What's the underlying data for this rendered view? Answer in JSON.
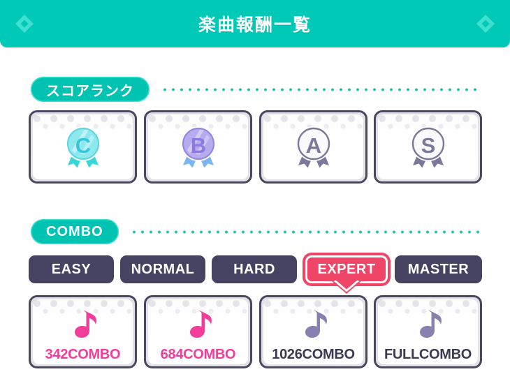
{
  "header": {
    "title": "楽曲報酬一覧",
    "background_color": "#00c9b7",
    "left_icon": "diamond-icon",
    "right_icon": "diamond-icon"
  },
  "score_rank_section": {
    "label": "スコアランク",
    "pill_color": "#00c3b2",
    "cards": [
      {
        "rank": "C",
        "achieved": true,
        "medal_color": "#45dce6",
        "letter_color": "#3ec8d8"
      },
      {
        "rank": "B",
        "achieved": true,
        "medal_color": "#a79aea",
        "letter_color": "#8f7fe0"
      },
      {
        "rank": "A",
        "achieved": false,
        "medal_color": "#f2f2f6",
        "letter_color": "#7b789c"
      },
      {
        "rank": "S",
        "achieved": false,
        "medal_color": "#f2f2f6",
        "letter_color": "#7b789c"
      }
    ]
  },
  "combo_section": {
    "label": "COMBO",
    "pill_color": "#00c3b2",
    "difficulty_tabs": [
      {
        "label": "EASY",
        "selected": false
      },
      {
        "label": "NORMAL",
        "selected": false
      },
      {
        "label": "HARD",
        "selected": false
      },
      {
        "label": "EXPERT",
        "selected": true
      },
      {
        "label": "MASTER",
        "selected": false
      }
    ],
    "selected_tab_color": "#ef4566",
    "tab_color": "#454262",
    "cards": [
      {
        "label": "342COMBO",
        "achieved": true,
        "note_color": "#f23d9a"
      },
      {
        "label": "684COMBO",
        "achieved": true,
        "note_color": "#f23d9a"
      },
      {
        "label": "1026COMBO",
        "achieved": false,
        "note_color": "#8881ad"
      },
      {
        "label": "FULLCOMBO",
        "achieved": false,
        "note_color": "#8881ad"
      }
    ]
  }
}
